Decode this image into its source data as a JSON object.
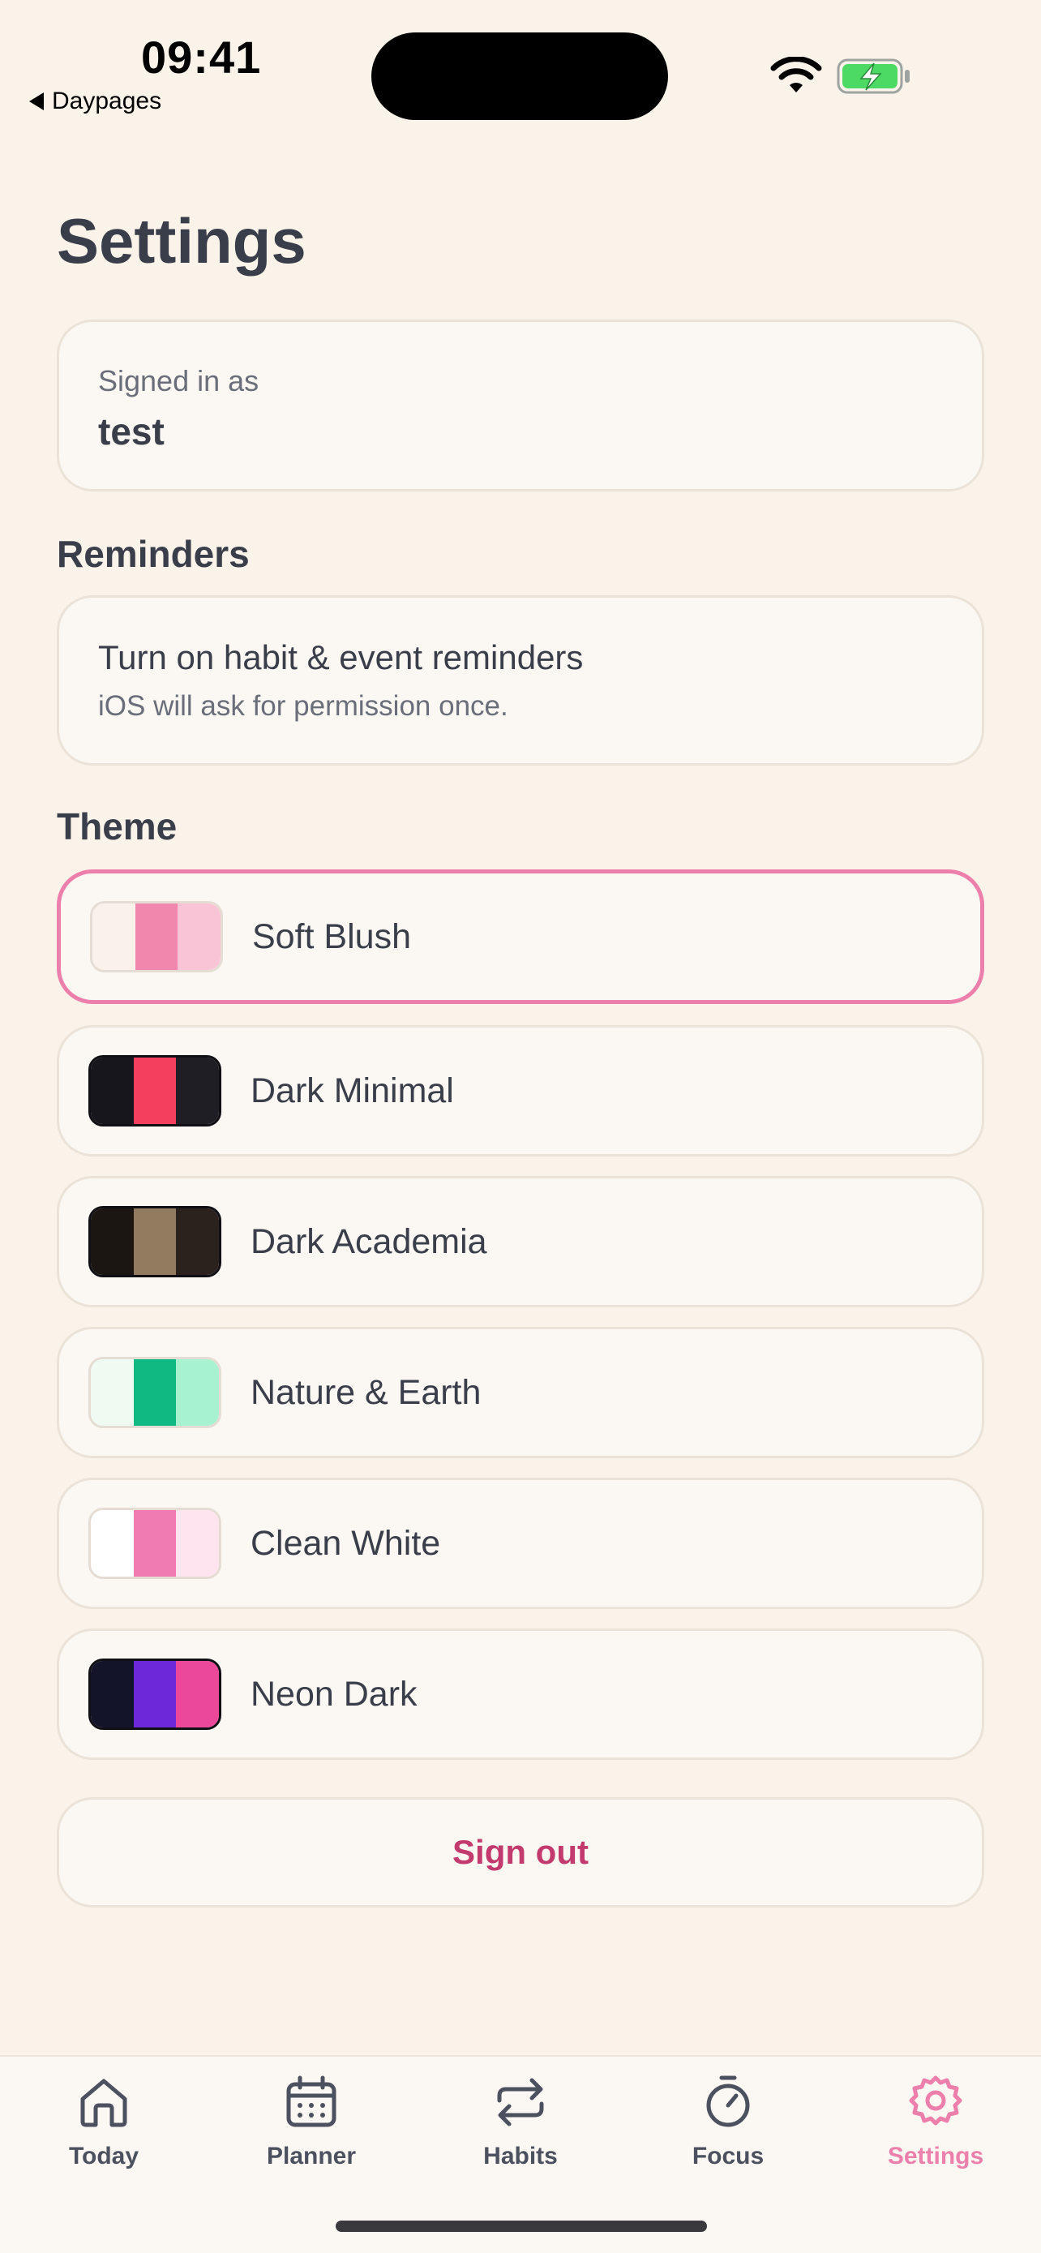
{
  "status_bar": {
    "time": "09:41",
    "back_app": "Daypages",
    "icons": [
      "wifi-icon",
      "battery-charging-icon"
    ]
  },
  "page": {
    "title": "Settings"
  },
  "account": {
    "label": "Signed in as",
    "username": "test"
  },
  "reminders": {
    "heading": "Reminders",
    "title": "Turn on habit & event reminders",
    "subtitle": "iOS will ask for permission once."
  },
  "theme": {
    "heading": "Theme",
    "selected": "Soft Blush",
    "accent_color": "#ec7fab",
    "items": [
      {
        "name": "Soft Blush",
        "colors": [
          "#faf1ea",
          "#f088ae",
          "#f9c5d6"
        ]
      },
      {
        "name": "Dark Minimal",
        "colors": [
          "#16161c",
          "#f43f5e",
          "#1e1e24"
        ]
      },
      {
        "name": "Dark Academia",
        "colors": [
          "#1c1613",
          "#937b5f",
          "#2b221e"
        ]
      },
      {
        "name": "Nature & Earth",
        "colors": [
          "#eefaf2",
          "#10b981",
          "#a7f3d0"
        ]
      },
      {
        "name": "Clean White",
        "colors": [
          "#ffffff",
          "#f07ab2",
          "#fde4ef"
        ]
      },
      {
        "name": "Neon Dark",
        "colors": [
          "#13132a",
          "#6d28d9",
          "#ec4899"
        ]
      }
    ]
  },
  "sign_out": {
    "label": "Sign out",
    "color": "#c23a6e"
  },
  "tab_bar": {
    "active": "Settings",
    "tabs": [
      {
        "label": "Today",
        "icon": "home-icon"
      },
      {
        "label": "Planner",
        "icon": "calendar-icon"
      },
      {
        "label": "Habits",
        "icon": "repeat-icon"
      },
      {
        "label": "Focus",
        "icon": "timer-icon"
      },
      {
        "label": "Settings",
        "icon": "gear-icon"
      }
    ]
  }
}
